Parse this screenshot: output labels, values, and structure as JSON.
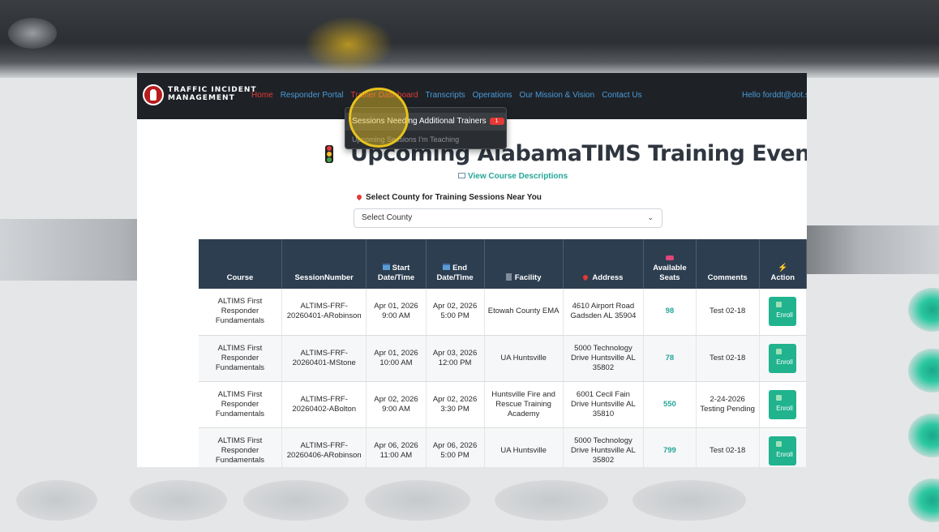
{
  "nav": {
    "brand_line1": "TRAFFIC INCIDENT",
    "brand_line2": "MANAGEMENT",
    "links": [
      "Home",
      "Responder Portal",
      "Trainer Dashboard",
      "Transcripts",
      "Operations",
      "Our Mission & Vision",
      "Contact Us"
    ],
    "hello": "Hello forddt@dot.st"
  },
  "dropdown": {
    "item1": "Sessions Needing Additional Trainers",
    "item1_badge": "1",
    "item2": "Upcoming Sessions I'm Teaching"
  },
  "page": {
    "title": "Upcoming AlabamaTIMS Training Events",
    "view_descriptions": "View Course Descriptions",
    "select_label": "Select County for Training Sessions Near You",
    "select_value": "Select County"
  },
  "table": {
    "headers": {
      "course": "Course",
      "session": "SessionNumber",
      "start_a": "Start",
      "start_b": "Date/Time",
      "end_a": "End",
      "end_b": "Date/Time",
      "facility": "Facility",
      "address": "Address",
      "seats_a": "Available",
      "seats_b": "Seats",
      "comments": "Comments",
      "action": "Action"
    },
    "enroll_label": "Enroll",
    "rows": [
      {
        "course": "ALTIMS First Responder Fundamentals",
        "session_a": "ALTIMS-FRF-",
        "session_b": "20260401-ARobinson",
        "start_a": "Apr 01, 2026",
        "start_b": "9:00 AM",
        "end_a": "Apr 02, 2026",
        "end_b": "5:00 PM",
        "facility": "Etowah County EMA",
        "address": "4610 Airport Road Gadsden AL 35904",
        "seats": "98",
        "comments": "Test 02-18"
      },
      {
        "course": "ALTIMS First Responder Fundamentals",
        "session_a": "ALTIMS-FRF-",
        "session_b": "20260401-MStone",
        "start_a": "Apr 01, 2026",
        "start_b": "10:00 AM",
        "end_a": "Apr 03, 2026",
        "end_b": "12:00 PM",
        "facility": "UA Huntsville",
        "address": "5000 Technology Drive Huntsville AL 35802",
        "seats": "78",
        "comments": "Test 02-18"
      },
      {
        "course": "ALTIMS First Responder Fundamentals",
        "session_a": "ALTIMS-FRF-",
        "session_b": "20260402-ABolton",
        "start_a": "Apr 02, 2026",
        "start_b": "9:00 AM",
        "end_a": "Apr 02, 2026",
        "end_b": "3:30 PM",
        "facility": "Huntsville Fire and Rescue Training Academy",
        "address": "6001 Cecil Fain Drive Huntsville AL 35810",
        "seats": "550",
        "comments": "2-24-2026 Testing Pending"
      },
      {
        "course": "ALTIMS First Responder Fundamentals",
        "session_a": "ALTIMS-FRF-",
        "session_b": "20260406-ARobinson",
        "start_a": "Apr 06, 2026",
        "start_b": "11:00 AM",
        "end_a": "Apr 06, 2026",
        "end_b": "5:00 PM",
        "facility": "UA Huntsville",
        "address": "5000 Technology Drive Huntsville AL 35802",
        "seats": "799",
        "comments": "Test 02-18"
      }
    ]
  },
  "colors": {
    "navbar_bg": "#1e2227",
    "accent_red": "#e53935",
    "link_blue": "#4b9bd9",
    "table_header": "#2d3e50",
    "teal": "#26a69a"
  }
}
